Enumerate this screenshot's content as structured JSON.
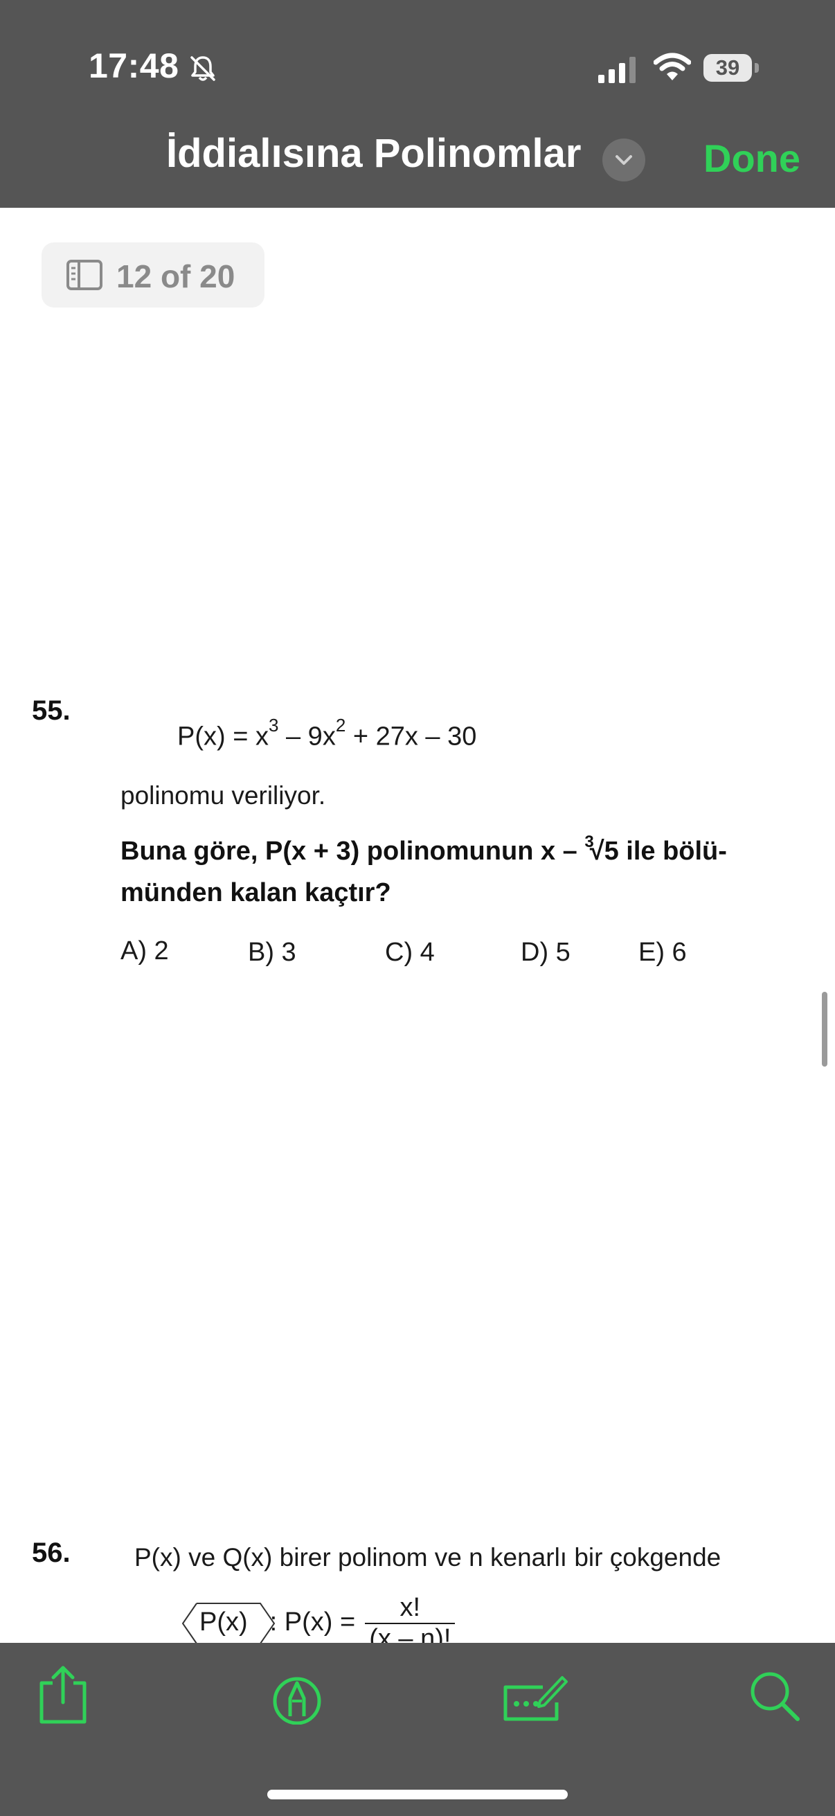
{
  "status_bar": {
    "time": "17:48",
    "battery": "39",
    "icons": [
      "bell-slash-icon",
      "cellular-signal-icon",
      "wifi-icon",
      "battery-icon"
    ]
  },
  "nav": {
    "title": "İddialısına Polinomlar",
    "done_label": "Done",
    "accent_color": "#30d158",
    "bar_color": "#555555"
  },
  "page_indicator": {
    "text": "12 of 20",
    "icon": "sidebar-icon"
  },
  "questions": [
    {
      "number": "55.",
      "formula": {
        "prefix": "P(x) = x",
        "exp1": "3",
        "mid": " – 9x",
        "exp2": "2",
        "suffix": " + 27x – 30"
      },
      "given": "polinomu veriliyor.",
      "prompt": {
        "part1": "Buna göre,  P(x + 3)  polinomunun  x – ",
        "root_index": "3",
        "root_symbol": "√",
        "radicand": "5",
        "part2": "  ile bölü-",
        "line2": "münden kalan kaçtır?"
      },
      "choices": [
        "A) 2",
        "B) 3",
        "C) 4",
        "D) 5",
        "E) 6"
      ]
    },
    {
      "number": "56.",
      "text": "P(x) ve Q(x) birer polinom ve n kenarlı bir çokgende",
      "def": {
        "box": "P(x)",
        "lhs": ": P(x) =",
        "numerator": "x!",
        "denominator": "(x – n)!"
      }
    }
  ],
  "toolbar": {
    "items": [
      "share-icon",
      "markup-icon",
      "form-fill-icon",
      "search-icon"
    ]
  }
}
